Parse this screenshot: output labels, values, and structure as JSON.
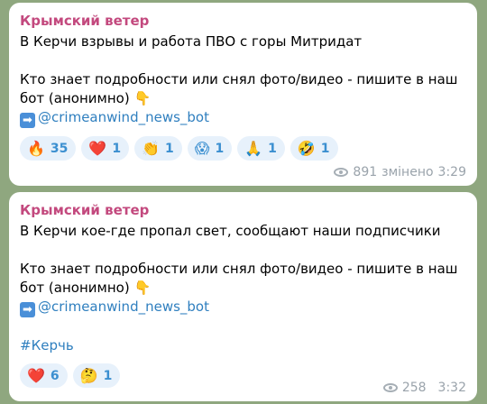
{
  "messages": [
    {
      "author": "Крымский ветер",
      "text_line1": "В Керчи взрывы и работа ПВО с горы Митридат",
      "text_line2": "Кто знает подробности или снял фото/видео - пишите в наш",
      "text_line3": "бот (анонимно)",
      "point_down_emoji": "👇",
      "arrow_emoji": "➡",
      "bot_link": "@crimeanwind_news_bot",
      "reactions": [
        {
          "emoji": "🔥",
          "count": "35"
        },
        {
          "emoji": "❤️",
          "count": "1"
        },
        {
          "emoji": "👏",
          "count": "1"
        },
        {
          "emoji": "😱",
          "count": "1"
        },
        {
          "emoji": "🙏",
          "count": "1"
        },
        {
          "emoji": "🤣",
          "count": "1"
        }
      ],
      "views": "891",
      "edited_label": "змінено",
      "time": "3:29"
    },
    {
      "author": "Крымский ветер",
      "text_line1": "В Керчи кое-где пропал свет, сообщают наши подписчики",
      "text_line2": "Кто знает подробности или снял фото/видео - пишите в наш",
      "text_line3": "бот (анонимно)",
      "point_down_emoji": "👇",
      "arrow_emoji": "➡",
      "bot_link": "@crimeanwind_news_bot",
      "hashtag": "#Керчь",
      "reactions": [
        {
          "emoji": "❤️",
          "count": "6"
        },
        {
          "emoji": "🤔",
          "count": "1"
        }
      ],
      "views": "258",
      "time": "3:32"
    }
  ],
  "colors": {
    "background": "#8fa77f",
    "author": "#c3497e",
    "link": "#2f7fbf",
    "reaction_bg": "#e7f1fb",
    "reaction_text": "#3b8fd0",
    "meta": "#9aa3ab"
  },
  "icons": {
    "views": "eye-icon"
  }
}
